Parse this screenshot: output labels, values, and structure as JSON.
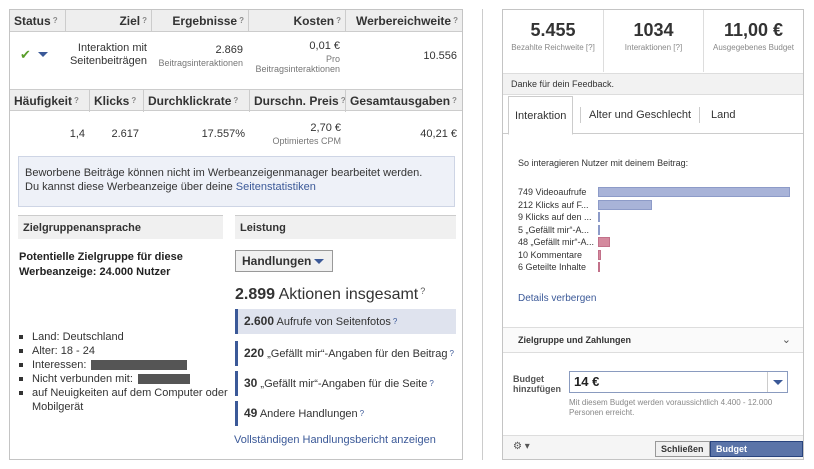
{
  "left": {
    "table1": {
      "headers": [
        "Status",
        "Ziel",
        "Ergebnisse",
        "Kosten",
        "Werbereichweite"
      ],
      "row": {
        "ziel": "Interaktion mit Seitenbeiträgen",
        "ergebnisse_value": "2.869",
        "ergebnisse_sub": "Beitragsinteraktionen",
        "kosten_value": "0,01 €",
        "kosten_sub1": "Pro",
        "kosten_sub2": "Beitragsinteraktionen",
        "reichweite": "10.556"
      }
    },
    "table2": {
      "headers": [
        "Häufigkeit",
        "Klicks",
        "Durchklickrate",
        "Durschn. Preis",
        "Gesamtausgaben"
      ],
      "row": {
        "haeufigkeit": "1,4",
        "klicks": "2.617",
        "durchklickrate": "17.557%",
        "preis_value": "2,70 €",
        "preis_sub": "Optimiertes CPM",
        "gesamtausgaben": "40,21 €"
      }
    },
    "notice": {
      "line1": "Beworbene Beiträge können nicht im Werbeanzeigenmanager bearbeitet werden.",
      "line2": "Du kannst diese Werbeanzeige über deine ",
      "link": "Seitenstatistiken"
    },
    "zielgruppe": {
      "heading": "Zielgruppenansprache",
      "potential": "Potentielle Zielgruppe für diese Werbeanzeige: 24.000 Nutzer",
      "bullets": [
        "Land: Deutschland",
        "Alter: 18 - 24",
        "Interessen:",
        "Nicht verbunden mit:",
        "auf Neuigkeiten auf dem Computer oder Mobilgerät"
      ]
    },
    "leistung": {
      "heading": "Leistung",
      "dropdown": "Handlungen",
      "total_value": "2.899",
      "total_label": "Aktionen insgesamt",
      "rows": [
        {
          "value": "2.600",
          "label": "Aufrufe von Seitenfotos"
        },
        {
          "value": "220",
          "label": "„Gefällt mir“-Angaben für den Beitrag"
        },
        {
          "value": "30",
          "label": "„Gefällt mir“-Angaben für die Seite"
        },
        {
          "value": "49",
          "label": "Andere Handlungen"
        }
      ],
      "report_link": "Vollständigen Handlungsbericht anzeigen"
    }
  },
  "right": {
    "stats": [
      {
        "value": "5.455",
        "label": "Bezahlte Reichweite",
        "q": "[?]"
      },
      {
        "value": "1034",
        "label": "Interaktionen",
        "q": "[?]"
      },
      {
        "value": "11,00 €",
        "label": "Ausgegebenes Budget",
        "q": ""
      }
    ],
    "feedback": "Danke für dein Feedback.",
    "tabs": [
      "Interaktion",
      "Alter und Geschlecht",
      "Land"
    ],
    "interaction_title": "So interagieren Nutzer mit deinem Beitrag:",
    "bars": [
      {
        "label": "749 Videoaufrufe",
        "value": 749,
        "color": "#a8b3d8"
      },
      {
        "label": "212 Klicks auf F...",
        "value": 212,
        "color": "#a8b3d8"
      },
      {
        "label": "9 Klicks auf den ...",
        "value": 9,
        "color": "#a8b3d8"
      },
      {
        "label": "5 „Gefällt mir“-A...",
        "value": 5,
        "color": "#a8b3d8"
      },
      {
        "label": "48 „Gefällt mir“-A...",
        "value": 48,
        "color": "#d48a9e"
      },
      {
        "label": "10 Kommentare",
        "value": 10,
        "color": "#d48a9e"
      },
      {
        "label": "6 Geteilte Inhalte",
        "value": 6,
        "color": "#d48a9e"
      }
    ],
    "details_link": "Details verbergen",
    "zielgruppe_zahlungen": "Zielgruppe und Zahlungen",
    "budget_label_1": "Budget",
    "budget_label_2": "hinzufügen",
    "budget_value": "14 €",
    "budget_help": "Mit diesem Budget werden voraussichtlich 4.400 - 12.000 Personen erreicht.",
    "close_button": "Schließen",
    "add_budget_button": "Budget hinzufügen",
    "q_mark": "?"
  }
}
